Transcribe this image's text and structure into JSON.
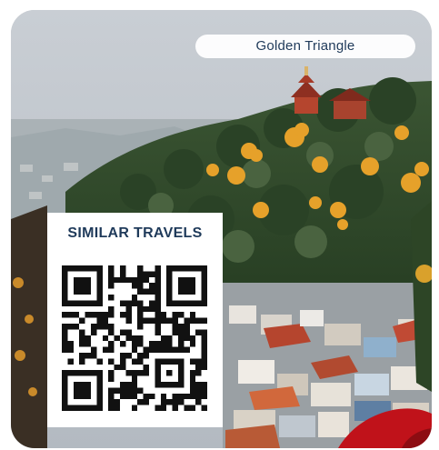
{
  "card": {
    "destination_tag": "Golden Triangle",
    "qr_title": "SIMILAR TRAVELS"
  },
  "image": {
    "subject": "hillside-town-photo",
    "colors": {
      "sky": "#c3c9cf",
      "hill": "#2f4a2a",
      "blossom": "#e6a12a",
      "roof_red": "#b5452e",
      "accent_red": "#c0121a"
    }
  },
  "colors": {
    "tag_text": "#1f3a5a",
    "qr_title_text": "#1f3a5a",
    "panel_bg": "#ffffff"
  }
}
